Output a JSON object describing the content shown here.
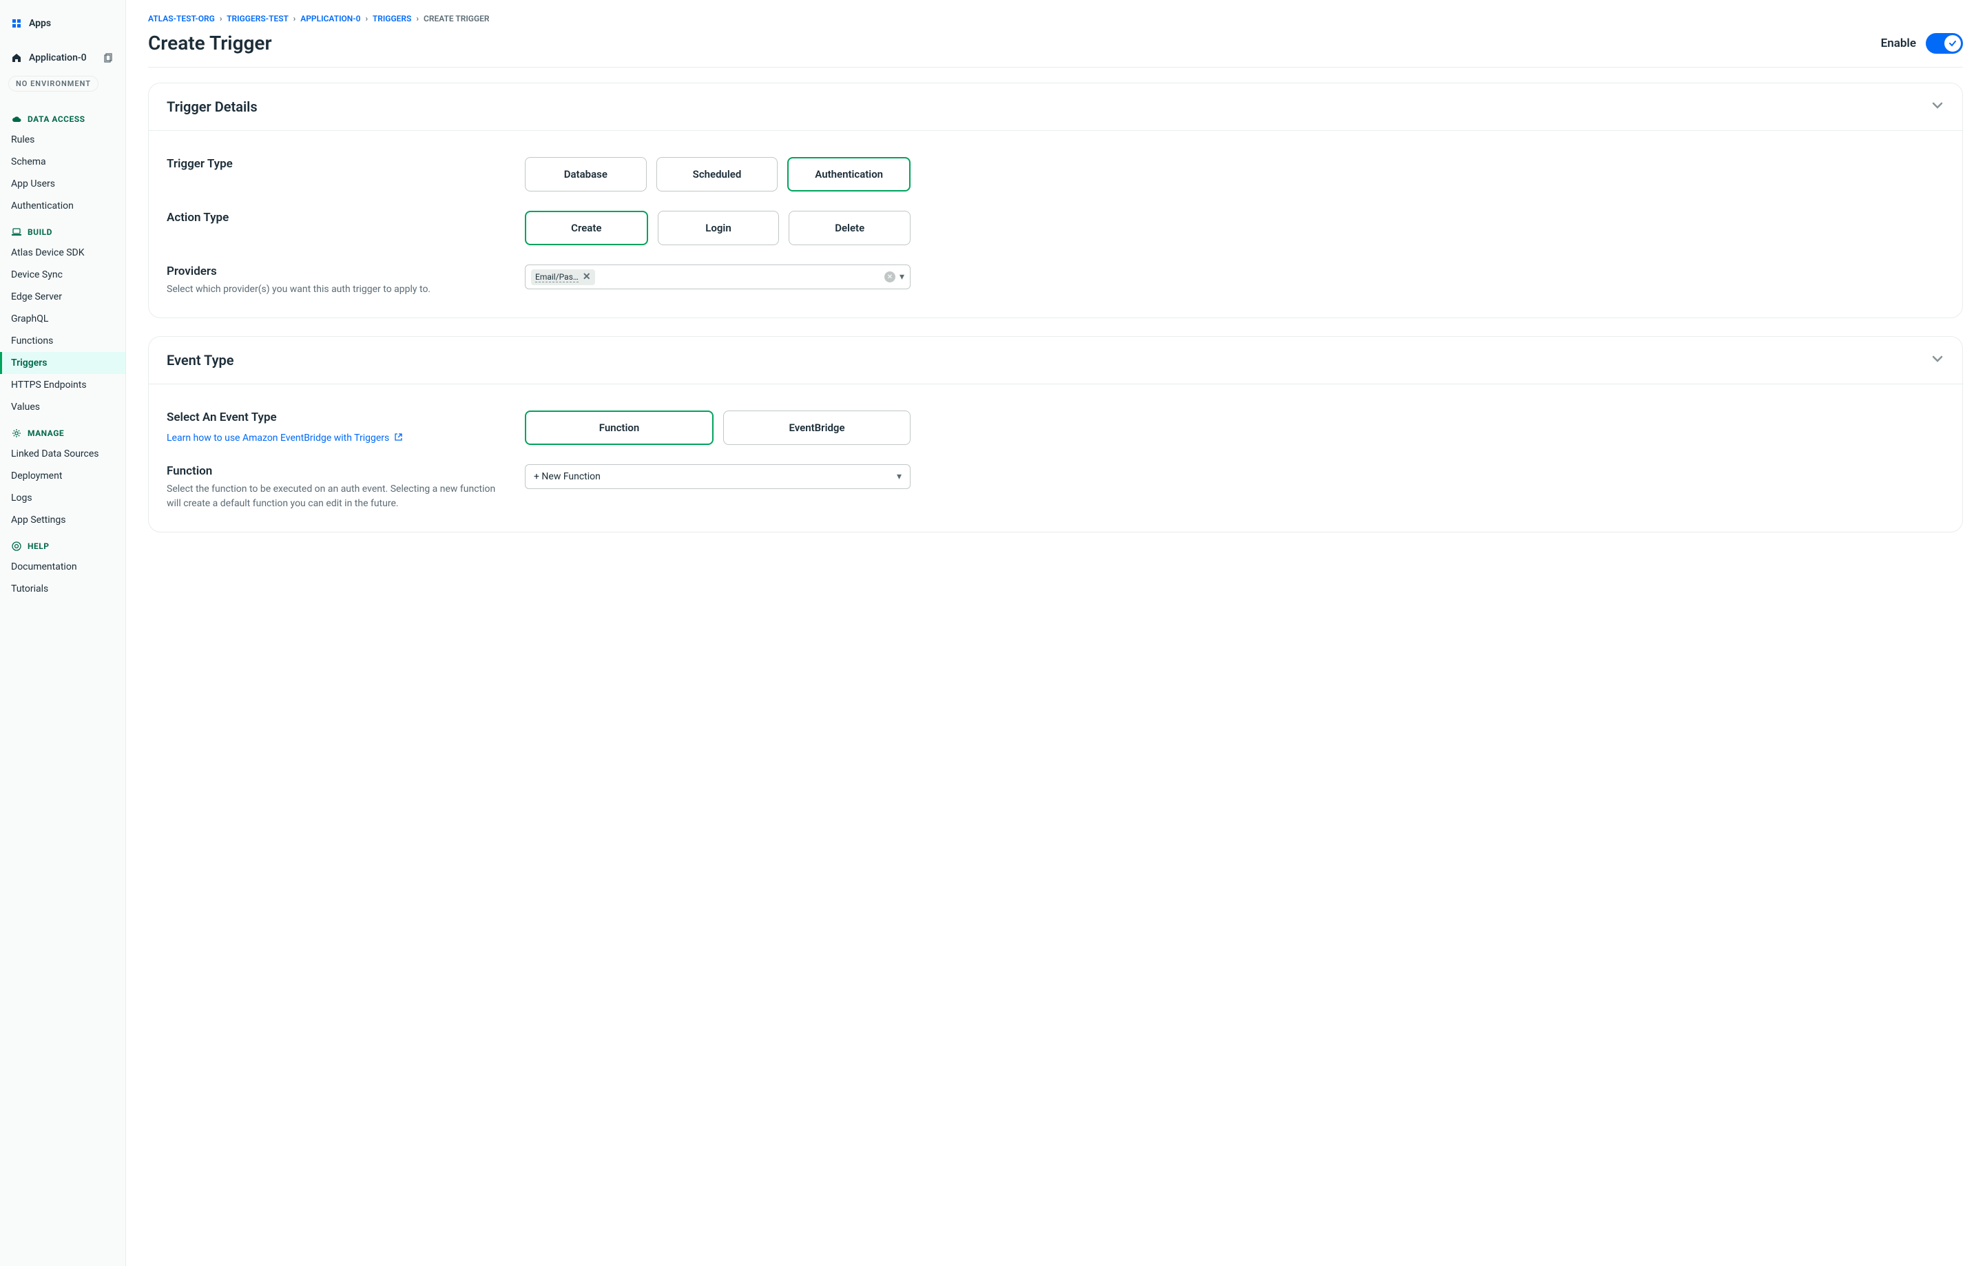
{
  "sidebar": {
    "apps_label": "Apps",
    "app_name": "Application-0",
    "env_badge": "NO ENVIRONMENT",
    "sections": {
      "data_access": {
        "title": "DATA ACCESS",
        "items": [
          "Rules",
          "Schema",
          "App Users",
          "Authentication"
        ]
      },
      "build": {
        "title": "BUILD",
        "items": [
          "Atlas Device SDK",
          "Device Sync",
          "Edge Server",
          "GraphQL",
          "Functions",
          "Triggers",
          "HTTPS Endpoints",
          "Values"
        ],
        "active_index": 5
      },
      "manage": {
        "title": "MANAGE",
        "items": [
          "Linked Data Sources",
          "Deployment",
          "Logs",
          "App Settings"
        ]
      },
      "help": {
        "title": "HELP",
        "items": [
          "Documentation",
          "Tutorials"
        ]
      }
    }
  },
  "breadcrumb": {
    "items": [
      "ATLAS-TEST-ORG",
      "TRIGGERS-TEST",
      "APPLICATION-0",
      "TRIGGERS"
    ],
    "current": "CREATE TRIGGER"
  },
  "header": {
    "title": "Create Trigger",
    "enable_label": "Enable",
    "enabled": true
  },
  "sections": {
    "trigger_details": {
      "title": "Trigger Details",
      "trigger_type": {
        "label": "Trigger Type",
        "options": [
          "Database",
          "Scheduled",
          "Authentication"
        ],
        "selected": 2
      },
      "action_type": {
        "label": "Action Type",
        "options": [
          "Create",
          "Login",
          "Delete"
        ],
        "selected": 0
      },
      "providers": {
        "label": "Providers",
        "desc": "Select which provider(s) you want this auth trigger to apply to.",
        "chips": [
          "Email/Pas…"
        ]
      }
    },
    "event_type": {
      "title": "Event Type",
      "select_event": {
        "label": "Select An Event Type",
        "link": "Learn how to use Amazon EventBridge with Triggers",
        "options": [
          "Function",
          "EventBridge"
        ],
        "selected": 0
      },
      "function": {
        "label": "Function",
        "desc": "Select the function to be executed on an auth event. Selecting a new function will create a default function you can edit in the future.",
        "selected": "+ New Function"
      }
    }
  }
}
